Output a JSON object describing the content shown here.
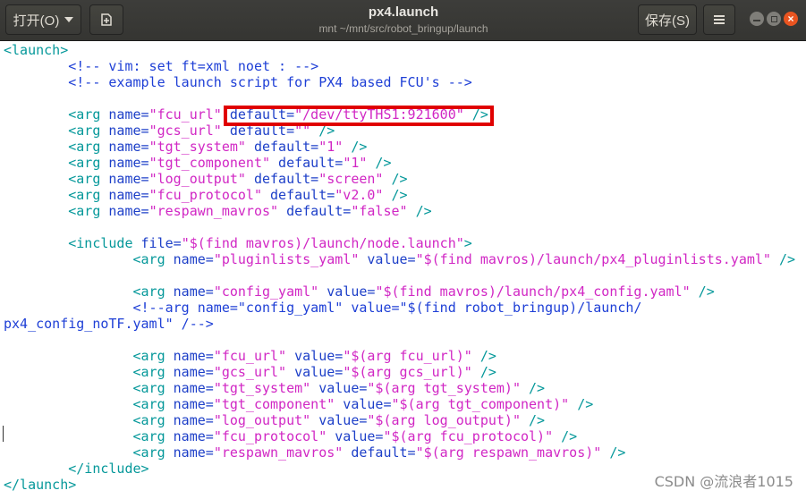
{
  "header": {
    "open_label": "打开(O)",
    "save_label": "保存(S)",
    "title": "px4.launch",
    "subtitle": "mnt ~/mnt/src/robot_bringup/launch"
  },
  "editor": {
    "lines": [
      [
        {
          "c": "tag",
          "t": "<launch>"
        }
      ],
      [
        {
          "c": "plain",
          "t": "        "
        },
        {
          "c": "cmt",
          "t": "<!-- vim: set ft=xml noet : -->"
        }
      ],
      [
        {
          "c": "plain",
          "t": "        "
        },
        {
          "c": "cmt",
          "t": "<!-- example launch script for PX4 based FCU's -->"
        }
      ],
      [
        {
          "c": "plain",
          "t": ""
        }
      ],
      [
        {
          "c": "plain",
          "t": "        "
        },
        {
          "c": "tag",
          "t": "<arg "
        },
        {
          "c": "attr",
          "t": "name="
        },
        {
          "c": "val",
          "t": "\"fcu_url\""
        },
        {
          "c": "attr",
          "t": " default="
        },
        {
          "c": "val",
          "t": "\"/dev/ttyTHS1:921600\""
        },
        {
          "c": "tag",
          "t": " />"
        }
      ],
      [
        {
          "c": "plain",
          "t": "        "
        },
        {
          "c": "tag",
          "t": "<arg "
        },
        {
          "c": "attr",
          "t": "name="
        },
        {
          "c": "val",
          "t": "\"gcs_url\""
        },
        {
          "c": "attr",
          "t": " default="
        },
        {
          "c": "val",
          "t": "\"\""
        },
        {
          "c": "tag",
          "t": " />"
        }
      ],
      [
        {
          "c": "plain",
          "t": "        "
        },
        {
          "c": "tag",
          "t": "<arg "
        },
        {
          "c": "attr",
          "t": "name="
        },
        {
          "c": "val",
          "t": "\"tgt_system\""
        },
        {
          "c": "attr",
          "t": " default="
        },
        {
          "c": "val",
          "t": "\"1\""
        },
        {
          "c": "tag",
          "t": " />"
        }
      ],
      [
        {
          "c": "plain",
          "t": "        "
        },
        {
          "c": "tag",
          "t": "<arg "
        },
        {
          "c": "attr",
          "t": "name="
        },
        {
          "c": "val",
          "t": "\"tgt_component\""
        },
        {
          "c": "attr",
          "t": " default="
        },
        {
          "c": "val",
          "t": "\"1\""
        },
        {
          "c": "tag",
          "t": " />"
        }
      ],
      [
        {
          "c": "plain",
          "t": "        "
        },
        {
          "c": "tag",
          "t": "<arg "
        },
        {
          "c": "attr",
          "t": "name="
        },
        {
          "c": "val",
          "t": "\"log_output\""
        },
        {
          "c": "attr",
          "t": " default="
        },
        {
          "c": "val",
          "t": "\"screen\""
        },
        {
          "c": "tag",
          "t": " />"
        }
      ],
      [
        {
          "c": "plain",
          "t": "        "
        },
        {
          "c": "tag",
          "t": "<arg "
        },
        {
          "c": "attr",
          "t": "name="
        },
        {
          "c": "val",
          "t": "\"fcu_protocol\""
        },
        {
          "c": "attr",
          "t": " default="
        },
        {
          "c": "val",
          "t": "\"v2.0\""
        },
        {
          "c": "tag",
          "t": " />"
        }
      ],
      [
        {
          "c": "plain",
          "t": "        "
        },
        {
          "c": "tag",
          "t": "<arg "
        },
        {
          "c": "attr",
          "t": "name="
        },
        {
          "c": "val",
          "t": "\"respawn_mavros\""
        },
        {
          "c": "attr",
          "t": " default="
        },
        {
          "c": "val",
          "t": "\"false\""
        },
        {
          "c": "tag",
          "t": " />"
        }
      ],
      [
        {
          "c": "plain",
          "t": ""
        }
      ],
      [
        {
          "c": "plain",
          "t": "        "
        },
        {
          "c": "tag",
          "t": "<include "
        },
        {
          "c": "attr",
          "t": "file="
        },
        {
          "c": "val",
          "t": "\"$(find mavros)/launch/node.launch\""
        },
        {
          "c": "tag",
          "t": ">"
        }
      ],
      [
        {
          "c": "plain",
          "t": "                "
        },
        {
          "c": "tag",
          "t": "<arg "
        },
        {
          "c": "attr",
          "t": "name="
        },
        {
          "c": "val",
          "t": "\"pluginlists_yaml\""
        },
        {
          "c": "attr",
          "t": " value="
        },
        {
          "c": "val",
          "t": "\"$(find mavros)/launch/px4_pluginlists.yaml\""
        },
        {
          "c": "tag",
          "t": " />"
        }
      ],
      [
        {
          "c": "plain",
          "t": ""
        }
      ],
      [
        {
          "c": "plain",
          "t": "                "
        },
        {
          "c": "tag",
          "t": "<arg "
        },
        {
          "c": "attr",
          "t": "name="
        },
        {
          "c": "val",
          "t": "\"config_yaml\""
        },
        {
          "c": "attr",
          "t": " value="
        },
        {
          "c": "val",
          "t": "\"$(find mavros)/launch/px4_config.yaml\""
        },
        {
          "c": "tag",
          "t": " />"
        }
      ],
      [
        {
          "c": "plain",
          "t": "                "
        },
        {
          "c": "cmt",
          "t": "<!--arg name=\"config_yaml\" value=\"$(find robot_bringup)/launch/"
        }
      ],
      [
        {
          "c": "cmt",
          "t": "px4_config_noTF.yaml\" /-->"
        }
      ],
      [
        {
          "c": "plain",
          "t": ""
        }
      ],
      [
        {
          "c": "plain",
          "t": "                "
        },
        {
          "c": "tag",
          "t": "<arg "
        },
        {
          "c": "attr",
          "t": "name="
        },
        {
          "c": "val",
          "t": "\"fcu_url\""
        },
        {
          "c": "attr",
          "t": " value="
        },
        {
          "c": "val",
          "t": "\"$(arg fcu_url)\""
        },
        {
          "c": "tag",
          "t": " />"
        }
      ],
      [
        {
          "c": "plain",
          "t": "                "
        },
        {
          "c": "tag",
          "t": "<arg "
        },
        {
          "c": "attr",
          "t": "name="
        },
        {
          "c": "val",
          "t": "\"gcs_url\""
        },
        {
          "c": "attr",
          "t": " value="
        },
        {
          "c": "val",
          "t": "\"$(arg gcs_url)\""
        },
        {
          "c": "tag",
          "t": " />"
        }
      ],
      [
        {
          "c": "plain",
          "t": "                "
        },
        {
          "c": "tag",
          "t": "<arg "
        },
        {
          "c": "attr",
          "t": "name="
        },
        {
          "c": "val",
          "t": "\"tgt_system\""
        },
        {
          "c": "attr",
          "t": " value="
        },
        {
          "c": "val",
          "t": "\"$(arg tgt_system)\""
        },
        {
          "c": "tag",
          "t": " />"
        }
      ],
      [
        {
          "c": "plain",
          "t": "                "
        },
        {
          "c": "tag",
          "t": "<arg "
        },
        {
          "c": "attr",
          "t": "name="
        },
        {
          "c": "val",
          "t": "\"tgt_component\""
        },
        {
          "c": "attr",
          "t": " value="
        },
        {
          "c": "val",
          "t": "\"$(arg tgt_component)\""
        },
        {
          "c": "tag",
          "t": " />"
        }
      ],
      [
        {
          "c": "plain",
          "t": "                "
        },
        {
          "c": "tag",
          "t": "<arg "
        },
        {
          "c": "attr",
          "t": "name="
        },
        {
          "c": "val",
          "t": "\"log_output\""
        },
        {
          "c": "attr",
          "t": " value="
        },
        {
          "c": "val",
          "t": "\"$(arg log_output)\""
        },
        {
          "c": "tag",
          "t": " />"
        }
      ],
      [
        {
          "c": "plain",
          "t": "                "
        },
        {
          "c": "tag",
          "t": "<arg "
        },
        {
          "c": "attr",
          "t": "name="
        },
        {
          "c": "val",
          "t": "\"fcu_protocol\""
        },
        {
          "c": "attr",
          "t": " value="
        },
        {
          "c": "val",
          "t": "\"$(arg fcu_protocol)\""
        },
        {
          "c": "tag",
          "t": " />"
        }
      ],
      [
        {
          "c": "plain",
          "t": "                "
        },
        {
          "c": "tag",
          "t": "<arg "
        },
        {
          "c": "attr",
          "t": "name="
        },
        {
          "c": "val",
          "t": "\"respawn_mavros\""
        },
        {
          "c": "attr",
          "t": " default="
        },
        {
          "c": "val",
          "t": "\"$(arg respawn_mavros)\""
        },
        {
          "c": "tag",
          "t": " />"
        }
      ],
      [
        {
          "c": "plain",
          "t": "        "
        },
        {
          "c": "tag",
          "t": "</include>"
        }
      ],
      [
        {
          "c": "tag",
          "t": "</launch>"
        }
      ]
    ]
  },
  "watermark": "CSDN @流浪者1015",
  "colors": {
    "tag": "#05989a",
    "attribute": "#1d3fc8",
    "value": "#d127c4",
    "comment": "#1e3fd6",
    "highlight_box": "#e00000",
    "close_button": "#e95420"
  },
  "icons": {
    "open_dropdown": "chevron-down-icon",
    "new_document": "new-document-icon",
    "menu": "hamburger-menu-icon",
    "minimize": "minimize-icon",
    "maximize": "maximize-icon",
    "close": "close-icon"
  }
}
